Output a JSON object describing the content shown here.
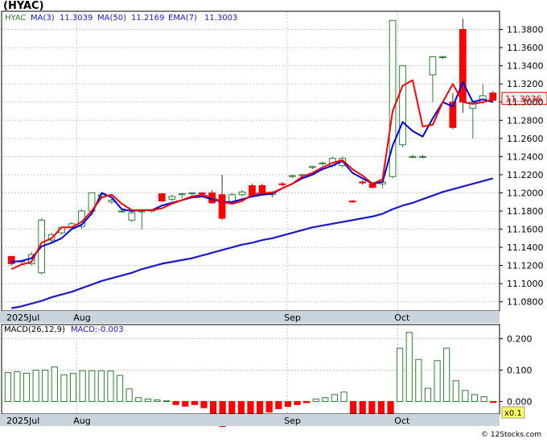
{
  "chart_data": [
    {
      "type": "candlestick",
      "title": "(HYAC)",
      "ticker": "HYAC",
      "ylim": [
        11.07,
        11.4
      ],
      "y_ticks": [
        "11.0800",
        "11.1000",
        "11.1200",
        "11.1400",
        "11.1600",
        "11.1800",
        "11.2000",
        "11.2200",
        "11.2400",
        "11.2600",
        "11.2800",
        "11.3000",
        "11.3200",
        "11.3400",
        "11.3600",
        "11.3800"
      ],
      "x_labels": [
        {
          "label": "2025Jul",
          "index": 0
        },
        {
          "label": "Aug",
          "index": 7
        },
        {
          "label": "Sep",
          "index": 28
        },
        {
          "label": "Oct",
          "index": 39
        }
      ],
      "legend": {
        "ticker": "HYAC",
        "ma3_label": "MA(3)",
        "ma3_value": "11.3039",
        "ma50_label": "MA(50)",
        "ma50_value": "11.2169",
        "ema7_label": "EMA(7)",
        "ema7_value": "11.3003"
      },
      "last_price": "11.3036",
      "candles": [
        [
          11.13,
          11.13,
          11.12,
          11.122
        ],
        [
          11.124,
          11.126,
          11.122,
          11.125
        ],
        [
          11.122,
          11.135,
          11.12,
          11.132
        ],
        [
          11.112,
          11.172,
          11.11,
          11.17
        ],
        [
          11.148,
          11.156,
          11.146,
          11.154
        ],
        [
          11.156,
          11.163,
          11.154,
          11.162
        ],
        [
          11.162,
          11.168,
          11.16,
          11.166
        ],
        [
          11.163,
          11.182,
          11.16,
          11.18
        ],
        [
          11.18,
          11.2,
          11.178,
          11.2
        ],
        [
          11.196,
          11.2,
          11.194,
          11.198
        ],
        [
          11.19,
          11.194,
          11.188,
          11.192
        ],
        [
          11.18,
          11.182,
          11.178,
          11.18
        ],
        [
          11.17,
          11.18,
          11.168,
          11.178
        ],
        [
          11.18,
          11.182,
          11.16,
          11.18
        ],
        [
          11.18,
          11.182,
          11.178,
          11.181
        ],
        [
          11.199,
          11.2,
          11.19,
          11.191
        ],
        [
          11.193,
          11.198,
          11.191,
          11.196
        ],
        [
          11.198,
          11.2,
          11.194,
          11.199
        ],
        [
          11.199,
          11.201,
          11.197,
          11.2
        ],
        [
          11.2,
          11.201,
          11.198,
          11.199
        ],
        [
          11.2,
          11.203,
          11.188,
          11.189
        ],
        [
          11.198,
          11.22,
          11.17,
          11.172
        ],
        [
          11.19,
          11.2,
          11.188,
          11.198
        ],
        [
          11.198,
          11.203,
          11.196,
          11.201
        ],
        [
          11.208,
          11.21,
          11.197,
          11.197
        ],
        [
          11.208,
          11.21,
          11.197,
          11.198
        ],
        [
          11.198,
          11.202,
          11.195,
          11.201
        ],
        [
          11.21,
          11.212,
          11.207,
          11.209
        ],
        [
          11.218,
          11.22,
          11.216,
          11.219
        ],
        [
          11.219,
          11.221,
          11.217,
          11.22
        ],
        [
          11.228,
          11.23,
          11.226,
          11.229
        ],
        [
          11.232,
          11.234,
          11.23,
          11.233
        ],
        [
          11.23,
          11.24,
          11.228,
          11.238
        ],
        [
          11.23,
          11.24,
          11.228,
          11.238
        ],
        [
          11.191,
          11.192,
          11.189,
          11.19
        ],
        [
          11.212,
          11.214,
          11.209,
          11.211
        ],
        [
          11.21,
          11.212,
          11.205,
          11.206
        ],
        [
          11.21,
          11.215,
          11.205,
          11.212
        ],
        [
          11.218,
          11.39,
          11.216,
          11.39
        ],
        [
          11.253,
          11.34,
          11.25,
          11.34
        ],
        [
          11.24,
          11.242,
          11.238,
          11.24
        ],
        [
          11.24,
          11.242,
          11.238,
          11.24
        ],
        [
          11.33,
          11.35,
          11.3,
          11.35
        ],
        [
          11.349,
          11.351,
          11.347,
          11.35
        ],
        [
          11.3,
          11.31,
          11.27,
          11.272
        ],
        [
          11.38,
          11.392,
          11.288,
          11.3
        ],
        [
          11.293,
          11.302,
          11.26,
          11.3
        ],
        [
          11.3,
          11.32,
          11.298,
          11.307
        ],
        [
          11.31,
          11.312,
          11.3,
          11.302
        ]
      ],
      "ma3": [
        11.116,
        11.121,
        11.124,
        11.145,
        11.15,
        11.162,
        11.162,
        11.168,
        11.18,
        11.195,
        11.198,
        11.188,
        11.181,
        11.181,
        11.181,
        11.183,
        11.188,
        11.192,
        11.196,
        11.198,
        11.195,
        11.19,
        11.188,
        11.191,
        11.198,
        11.2,
        11.2,
        11.205,
        11.21,
        11.218,
        11.222,
        11.228,
        11.233,
        11.236,
        11.226,
        11.219,
        11.21,
        11.215,
        11.29,
        11.318,
        11.324,
        11.273,
        11.275,
        11.3,
        11.32,
        11.3,
        11.298,
        11.3,
        11.303
      ],
      "ema7": [
        11.124,
        11.125,
        11.128,
        11.141,
        11.145,
        11.15,
        11.16,
        11.165,
        11.177,
        11.2,
        11.195,
        11.182,
        11.18,
        11.181,
        11.181,
        11.186,
        11.189,
        11.192,
        11.195,
        11.196,
        11.193,
        11.19,
        11.19,
        11.193,
        11.196,
        11.198,
        11.199,
        11.205,
        11.21,
        11.216,
        11.22,
        11.226,
        11.23,
        11.235,
        11.222,
        11.216,
        11.21,
        11.212,
        11.252,
        11.278,
        11.268,
        11.262,
        11.282,
        11.3,
        11.295,
        11.322,
        11.3,
        11.303,
        11.3
      ],
      "ma50": [
        11.073,
        11.075,
        11.078,
        11.081,
        11.085,
        11.088,
        11.091,
        11.095,
        11.099,
        11.103,
        11.106,
        11.109,
        11.112,
        11.116,
        11.119,
        11.122,
        11.124,
        11.126,
        11.128,
        11.131,
        11.134,
        11.137,
        11.14,
        11.143,
        11.145,
        11.148,
        11.15,
        11.153,
        11.156,
        11.159,
        11.162,
        11.164,
        11.166,
        11.168,
        11.17,
        11.172,
        11.174,
        11.177,
        11.182,
        11.186,
        11.189,
        11.193,
        11.197,
        11.201,
        11.204,
        11.207,
        11.21,
        11.213,
        11.216
      ],
      "colors": {
        "up": "#2e7d32",
        "down": "#ff0000",
        "ma3": "#ff0000",
        "ema7": "#0000dd",
        "ma50": "#1a1acc"
      }
    },
    {
      "type": "bar",
      "title": "MACD(26,12,9)",
      "legend": {
        "label": "MACD(26,12,9)",
        "macd_label": "MACD:-0.003"
      },
      "ylim": [
        -0.04,
        0.245
      ],
      "y_ticks": [
        "0.200",
        "0.100",
        "0.000"
      ],
      "multiplier": "x0.1",
      "x_labels": [
        {
          "label": "2025Jul",
          "index": 0
        },
        {
          "label": "Aug",
          "index": 7
        },
        {
          "label": "Sep",
          "index": 28
        },
        {
          "label": "Oct",
          "index": 39
        }
      ],
      "values": [
        0.092,
        0.095,
        0.09,
        0.1,
        0.1,
        0.11,
        0.085,
        0.089,
        0.098,
        0.098,
        0.098,
        0.097,
        0.083,
        0.04,
        0.012,
        0.008,
        0.005,
        0.002,
        -0.01,
        -0.015,
        -0.01,
        -0.02,
        -0.045,
        -0.08,
        -0.074,
        -0.074,
        -0.062,
        -0.044,
        -0.034,
        -0.023,
        -0.016,
        -0.01,
        -0.004,
        0.008,
        0.012,
        0.022,
        0.03,
        -0.05,
        -0.044,
        -0.066,
        -0.07,
        -0.051,
        0.17,
        0.22,
        0.134,
        0.042,
        0.13,
        0.17,
        0.066,
        0.035,
        0.022,
        0.015,
        -0.003
      ],
      "colors": {
        "positive": "#2e7d32",
        "negative": "#ff0000"
      }
    }
  ],
  "footer": {
    "watermark": "© 12Stocks.com"
  }
}
